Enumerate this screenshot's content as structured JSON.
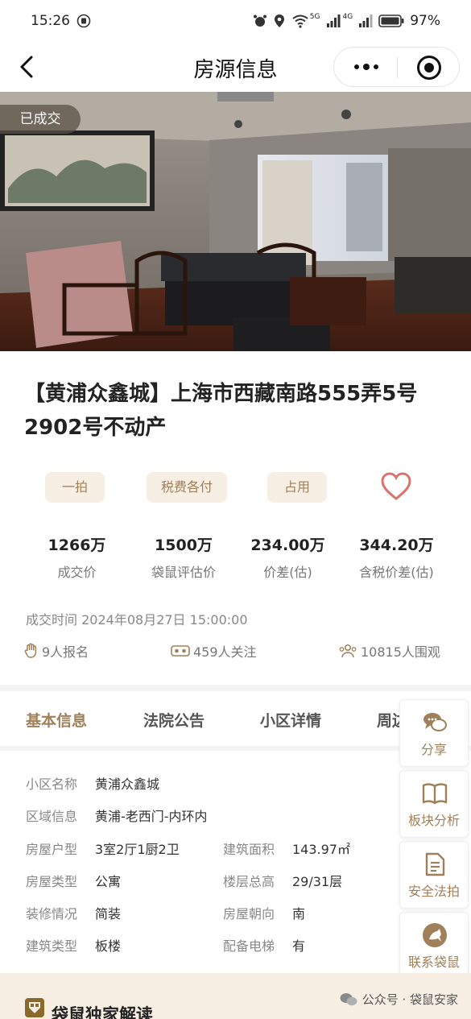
{
  "status_bar": {
    "time": "15:26",
    "network": "5G",
    "network2": "4G",
    "battery": "97%"
  },
  "nav": {
    "title": "房源信息"
  },
  "photo": {
    "badge": "已成交"
  },
  "listing": {
    "title": "【黄浦众鑫城】上海市西藏南路555弄5号2902号不动产",
    "tags": [
      "一拍",
      "税费各付",
      "占用"
    ],
    "stats": [
      {
        "value": "1266万",
        "label": "成交价"
      },
      {
        "value": "1500万",
        "label": "袋鼠评估价"
      },
      {
        "value": "234.00万",
        "label": "价差(估)"
      },
      {
        "value": "344.20万",
        "label": "含税价差(估)"
      }
    ],
    "deal_time_label": "成交时间",
    "deal_time": "2024年08月27日 15:00:00",
    "signups": "9人报名",
    "followers": "459人关注",
    "viewers": "10815人围观"
  },
  "tabs": [
    "基本信息",
    "法院公告",
    "小区详情",
    "周边"
  ],
  "basic_info": {
    "community_label": "小区名称",
    "community": "黄浦众鑫城",
    "area_label": "区域信息",
    "area": "黄浦-老西门-内环内",
    "layout_label": "房屋户型",
    "layout": "3室2厅1厨2卫",
    "built_area_label": "建筑面积",
    "built_area": "143.97㎡",
    "house_type_label": "房屋类型",
    "house_type": "公寓",
    "floors_label": "楼层总高",
    "floors": "29/31层",
    "decor_label": "装修情况",
    "decor": "简装",
    "orientation_label": "房屋朝向",
    "orientation": "南",
    "building_type_label": "建筑类型",
    "building_type": "板楼",
    "elevator_label": "配备电梯",
    "elevator": "有"
  },
  "actions": [
    "分享",
    "板块分析",
    "安全法拍",
    "联系袋鼠"
  ],
  "bottom": {
    "section_title": "袋鼠独家解读",
    "watermark": "公众号 · 袋鼠安家"
  },
  "colors": {
    "accent": "#a0805a",
    "tag_bg": "#f7efe4",
    "heart": "#d9736b"
  }
}
